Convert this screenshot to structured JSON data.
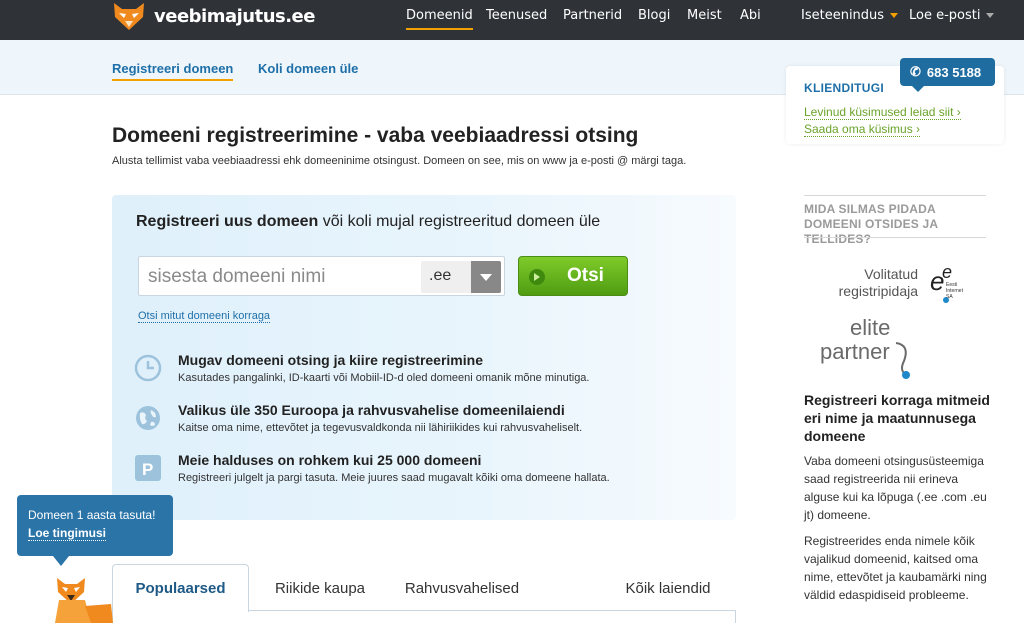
{
  "brand": {
    "name": "veebimajutus.ee",
    "logo_icon": "fox-logo-icon"
  },
  "topnav": {
    "items": [
      "Domeenid",
      "Teenused",
      "Partnerid",
      "Blogi",
      "Meist",
      "Abi"
    ],
    "active": "Domeenid",
    "self_service": "Iseteenindus",
    "read_email": "Loe e-posti"
  },
  "subnav": {
    "items": [
      "Registreeri domeen",
      "Koli domeen üle"
    ],
    "active": "Registreeri domeen"
  },
  "support": {
    "title": "KLIENDITUGI",
    "phone": "683 5188",
    "faq_link": "Levinud küsimused leiad siit ›",
    "ask_link": "Saada oma küsimus ›"
  },
  "main": {
    "title": "Domeeni registreerimine - vaba veebiaadressi otsing",
    "lede": "Alusta tellimist vaba veebiaadressi ehk domeeninime otsingust. Domeen on see, mis on www ja e-posti @ märgi taga.",
    "panel": {
      "heading_bold": "Registreeri uus domeen",
      "heading_rest": " või koli mujal registreeritud domeen üle",
      "search_placeholder": "sisesta domeeni nimi",
      "tld_value": ".ee",
      "search_button": "Otsi",
      "multi_search_link": "Otsi mitut domeeni korraga",
      "features": [
        {
          "icon": "clock-icon",
          "title": "Mugav domeeni otsing ja kiire registreerimine",
          "text": "Kasutades pangalinki, ID-kaarti või Mobiil-ID-d oled domeeni omanik mõne minutiga."
        },
        {
          "icon": "globe-icon",
          "title": "Valikus üle 350 Euroopa ja rahvusvahelise domeenilaiendi",
          "text": "Kaitse oma nime, ettevõtet ja tegevusvaldkonda nii lähiriikides kui rahvusvaheliselt."
        },
        {
          "icon": "parking-icon",
          "title": "Meie halduses on rohkem kui 25 000 domeeni",
          "text": "Registreeri julgelt ja pargi tasuta. Meie juures saad mugavalt kõiki oma domeene hallata."
        }
      ]
    },
    "tabs": [
      "Populaarsed",
      "Riikide kaupa",
      "Rahvusvahelised",
      "Kõik laiendid"
    ],
    "active_tab": "Populaarsed"
  },
  "promo": {
    "text": "Domeen 1 aasta tasuta!",
    "link": "Loe tingimusi"
  },
  "sidebar": {
    "heading": "MIDA SILMAS PIDADA DOMEENI OTSIDES JA TELLIDES?",
    "badge1_text": "Volitatud registripidaja",
    "badge1_logo_text": "Eesti Internet SA",
    "badge2_text": "elite partner",
    "title": "Registreeri korraga mitmeid eri nime ja maatunnusega domeene",
    "p1": "Vaba domeeni otsingusüsteemiga saad registreerida nii erineva alguse kui ka lõpuga (.ee .com .eu jt) domeene.",
    "p2": "Registreerides enda nimele kõik vajalikud domeenid, kaitsed oma nime, ettevõtet ja kaubamärki ning väldid edaspidiseid probleeme."
  },
  "colors": {
    "topbar": "#2f3338",
    "accent": "#f3a100",
    "link_blue": "#1e6fa8",
    "green": "#6aa32a",
    "button_green": "#5fae19"
  }
}
